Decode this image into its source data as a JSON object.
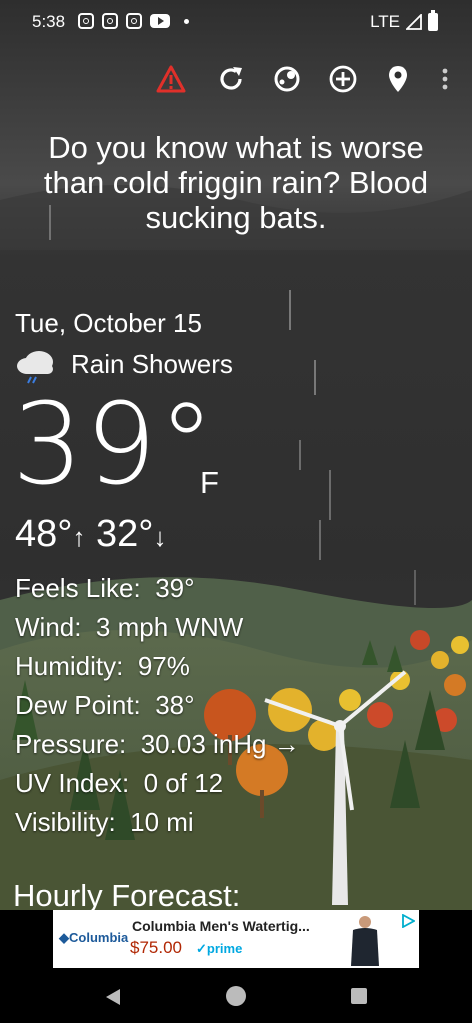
{
  "status_bar": {
    "time": "5:38",
    "network": "LTE"
  },
  "toolbar": {
    "icons": [
      "warning-icon",
      "refresh-icon",
      "radar-icon",
      "add-location-icon",
      "location-pin-icon",
      "more-options-icon"
    ],
    "warning_color": "#e0302a"
  },
  "headline": "Do you know what is worse than cold friggin rain? Blood sucking bats.",
  "current": {
    "date": "Tue, October 15",
    "condition": "Rain Showers",
    "condition_icon": "rain-cloud-icon",
    "temperature": "39°",
    "unit": "F",
    "high": "48°",
    "low": "32°"
  },
  "details": [
    {
      "label": "Feels Like:",
      "value": "39°"
    },
    {
      "label": "Wind:",
      "value": "3 mph WNW"
    },
    {
      "label": "Humidity:",
      "value": "97%"
    },
    {
      "label": "Dew Point:",
      "value": "38°"
    },
    {
      "label": "Pressure:",
      "value": "30.03 inHg →"
    },
    {
      "label": "UV Index:",
      "value": "0 of 12"
    },
    {
      "label": "Visibility:",
      "value": "10 mi"
    }
  ],
  "hourly_title": "Hourly Forecast:",
  "ad": {
    "brand": "Columbia",
    "title": "Columbia Men's Watertig...",
    "price": "$75.00",
    "prime": "prime"
  }
}
